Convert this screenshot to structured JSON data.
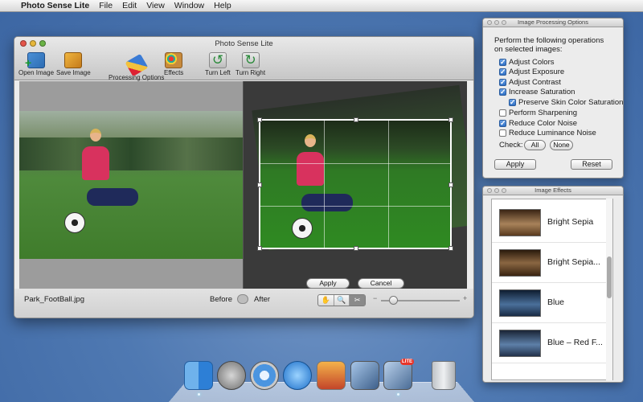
{
  "menubar": {
    "app_name": "Photo Sense Lite",
    "items": [
      "File",
      "Edit",
      "View",
      "Window",
      "Help"
    ]
  },
  "main_window": {
    "title": "Photo Sense Lite",
    "toolbar": [
      {
        "label": "Open Image",
        "icon": "open-image-icon"
      },
      {
        "label": "Save Image",
        "icon": "save-image-icon"
      },
      {
        "label": "Processing Options",
        "icon": "processing-options-icon"
      },
      {
        "label": "Effects",
        "icon": "effects-palette-icon"
      },
      {
        "label": "Turn Left",
        "icon": "rotate-left-icon"
      },
      {
        "label": "Turn Right",
        "icon": "rotate-right-icon"
      }
    ],
    "crop": {
      "apply_label": "Apply",
      "cancel_label": "Cancel"
    },
    "bottom": {
      "file_name": "Park_FootBall.jpg",
      "before_label": "Before",
      "after_label": "After",
      "zoom_level": 0.12
    }
  },
  "processing_panel": {
    "title": "Image Processing Options",
    "description_1": "Perform the following operations",
    "description_2": "on selected images:",
    "options": [
      {
        "label": "Adjust Colors",
        "checked": true
      },
      {
        "label": "Adjust Exposure",
        "checked": true
      },
      {
        "label": "Adjust Contrast",
        "checked": true
      },
      {
        "label": "Increase Saturation",
        "checked": true
      },
      {
        "label": "Preserve Skin Color Saturation",
        "checked": true
      },
      {
        "label": "Perform Sharpening",
        "checked": false
      },
      {
        "label": "Reduce Color Noise",
        "checked": true
      },
      {
        "label": "Reduce Luminance Noise",
        "checked": false
      }
    ],
    "check_label": "Check:",
    "all_label": "All",
    "none_label": "None",
    "apply_label": "Apply",
    "reset_label": "Reset"
  },
  "effects_panel": {
    "title": "Image Effects",
    "effects": [
      {
        "label": "Bright Sepia"
      },
      {
        "label": "Bright Sepia..."
      },
      {
        "label": "Blue"
      },
      {
        "label": "Blue – Red F..."
      }
    ]
  },
  "dock": {
    "items": [
      "finder-icon",
      "launchpad-icon",
      "safari-icon",
      "itunes-icon",
      "photo-app-icon",
      "photo-sense-icon",
      "photo-sense-lite-icon",
      "trash-icon"
    ]
  }
}
